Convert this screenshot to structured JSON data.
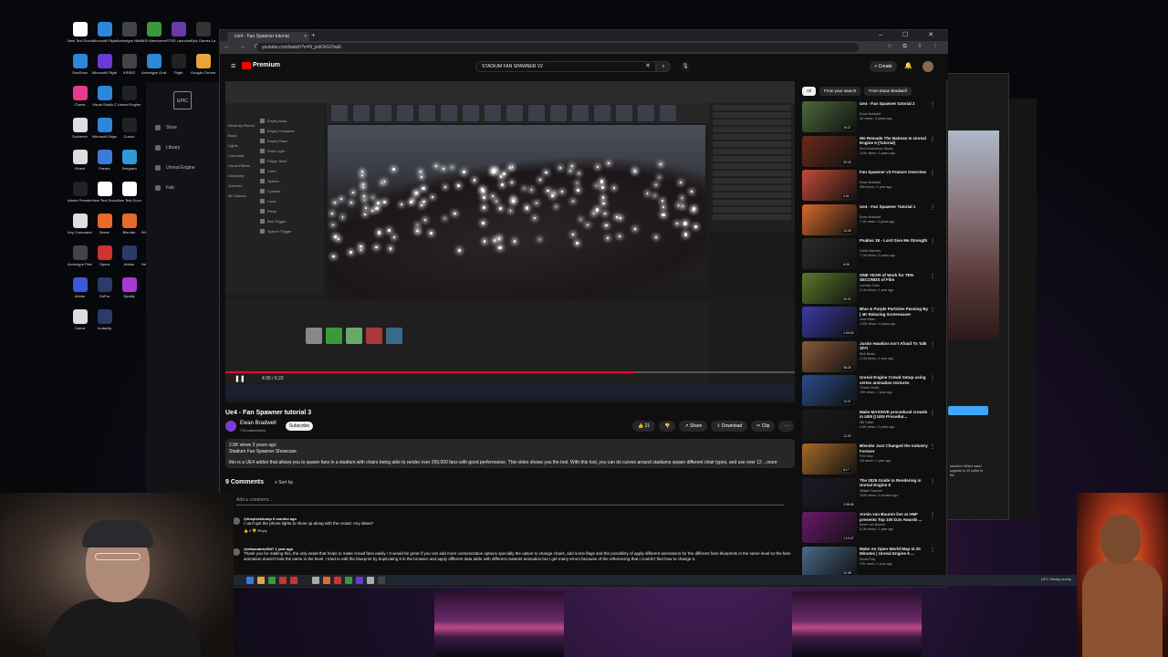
{
  "desktop": {
    "icons": [
      {
        "label": "New Text Document",
        "color": "#ffffff"
      },
      {
        "label": "Microsoft Flight Si...",
        "color": "#2e86d8"
      },
      {
        "label": "Archetype Nihilism",
        "color": "#444444"
      },
      {
        "label": "MSI Afterburner",
        "color": "#3a9a3a"
      },
      {
        "label": "RTSS Launcher",
        "color": "#6a3aa8"
      },
      {
        "label": "Epic Games Launcher",
        "color": "#333333"
      },
      {
        "label": "OneDrive",
        "color": "#2e86d8"
      },
      {
        "label": "Microsoft Flight Si...",
        "color": "#6a3ad8"
      },
      {
        "label": "KRISIS",
        "color": "#444444"
      },
      {
        "label": "Archetype Grabrush",
        "color": "#2e86d8"
      },
      {
        "label": "Flight",
        "color": "#222222"
      },
      {
        "label": "Google Chrome",
        "color": "#e8a33a"
      },
      {
        "label": "iTunes",
        "color": "#e83a8a"
      },
      {
        "label": "Visual Studio Code",
        "color": "#2e86d8"
      },
      {
        "label": "Unreal Engine",
        "color": "#222222"
      },
      {
        "label": "Fab",
        "color": "#cc3333"
      },
      {
        "label": "Archetype",
        "color": "#555555"
      },
      {
        "label": "SPOTIFY",
        "color": "#444444"
      },
      {
        "label": "Scrivener",
        "color": "#dddddd"
      },
      {
        "label": "Microsoft Edge",
        "color": "#2e86d8"
      },
      {
        "label": "Cursor",
        "color": "#222222"
      },
      {
        "label": "VRChat",
        "color": "#6a3ad8"
      },
      {
        "label": "Controller Pilot",
        "color": "#dddddd"
      },
      {
        "label": "Google Chrome",
        "color": "#3a9a3a"
      },
      {
        "label": "Kinect",
        "color": "#dddddd"
      },
      {
        "label": "Parsec",
        "color": "#3a7ad8"
      },
      {
        "label": "Telegram",
        "color": "#2e9ad8"
      },
      {
        "label": "Adobe",
        "color": "#3a5ad8"
      },
      {
        "label": "Skype",
        "color": "#2e9ad8"
      },
      {
        "label": "Recycle Bin",
        "color": "#dddddd"
      },
      {
        "label": "Adobe Premiere",
        "color": "#222222"
      },
      {
        "label": "New Text Document",
        "color": "#ffffff"
      },
      {
        "label": "New Text Document",
        "color": "#ffffff"
      },
      {
        "label": "Notion",
        "color": "#222222"
      },
      {
        "label": "New Text Document",
        "color": "#ffffff"
      },
      {
        "label": "Snipping Tool",
        "color": "#cc3333"
      },
      {
        "label": "Key Commands",
        "color": "#dddddd"
      },
      {
        "label": "Brave",
        "color": "#e86a2a"
      },
      {
        "label": "Blender",
        "color": "#e86a2a"
      },
      {
        "label": "World of Warcraft",
        "color": "#a87a2a"
      },
      {
        "label": "New Text Document",
        "color": "#ffffff"
      },
      {
        "label": "Brave",
        "color": "#a83a2a"
      },
      {
        "label": "Archetype Petrucci",
        "color": "#444444"
      },
      {
        "label": "Opera",
        "color": "#cc3333"
      },
      {
        "label": "Adobe",
        "color": "#2a3a6a"
      },
      {
        "label": "New Text Document",
        "color": "#ffffff"
      },
      {
        "label": "Archetype",
        "color": "#3a9a3a"
      },
      {
        "label": "Nvidia",
        "color": "#3a9a3a"
      },
      {
        "label": "Adobe",
        "color": "#3a5ad8"
      },
      {
        "label": "GoPro",
        "color": "#2a3a6a"
      },
      {
        "label": "Spotify",
        "color": "#a83ad8"
      },
      {
        "label": "Spotify",
        "color": "#dddddd"
      },
      {
        "label": "Adobe",
        "color": "#cc3333"
      },
      {
        "label": "Epic Games",
        "color": "#222222"
      },
      {
        "label": "Canva",
        "color": "#dddddd"
      },
      {
        "label": "Audacity",
        "color": "#2a3a6a"
      }
    ]
  },
  "epic_launcher": {
    "logo": "EPIC",
    "nav": [
      "Store",
      "Library",
      "Unreal Engine",
      "Fab"
    ]
  },
  "browser": {
    "tab_title": "Ue4 - Fan Spawner tutorial",
    "tab_close": "×",
    "new_tab": "+",
    "window_controls": "– ☐ ✕",
    "nav_buttons": "← → ⟳",
    "url": "youtube.com/watch?v=N_pxK3rGl7w&t",
    "extensions": "☆ ⧉ ⇩ ⋮"
  },
  "youtube": {
    "menu": "≡",
    "logo_text": "Premium",
    "search_value": "STADIUM FAN SPAWNER V2",
    "search_clear": "✕",
    "search_icon": "⌕",
    "mic_icon": "🎙",
    "create_label": "+ Create",
    "bell_icon": "🔔",
    "player": {
      "time": "4:35 / 6:23",
      "play_icon": "❚❚",
      "progress": 0.72,
      "progress_color": "#ff0033"
    },
    "video": {
      "title": "Ue4 - Fan Spawner tutorial 3",
      "channel": "Ewan Bradwell",
      "subscribers": "718 subscribers",
      "subscribe_label": "Subscribe",
      "like_count": "👍 21",
      "dislike": "👎",
      "share": "↗ Share",
      "download": "⇩ Download",
      "clip": "✂ Clip",
      "more": "⋯",
      "views": "2.5K views  3 years ago",
      "desc_title": "Stadium Fan Spawner Showcase",
      "desc_body": "this is a UE4 addon that allows you to spawn fans in a stadium with chairs being able to render over 250,000 fans with good performance. This video shows you the tool. With this tool, you can do curves around stadiums spawn different chair types, and use over 12 ...more"
    },
    "comments": {
      "count": "9 Comments",
      "sort_by": "≡ Sort by",
      "add_placeholder": "Add a comment...",
      "items": [
        {
          "author": "@thepixelslump  6 months ago",
          "text": "I can't get the phone lights to show up along with the crowd.  Any ideas?",
          "reply": "👍 0  👎  Reply"
        },
        {
          "author": "@ofmanatrix9647  1 year ago",
          "text": "Thank you for making this, the only asset that helps to make crowd fans easily ! It would be great if you can add more customization options specially the option to change chairs, add some flags and the possibility of apply different animations for the different fans blueprints in the same level so the fans animation doesn't look the same in the level. I tried to edit the blueprint by duplicating it in the browser and apply different data table with different materiel animation but I get many errors because of the referencing that I couldn't find how to change it.",
          "reply": ""
        }
      ]
    },
    "chips": [
      "All",
      "From your search",
      "From Ewan Bradwell"
    ],
    "recommendations": [
      {
        "title": "Ue4 - Fan Spawner tutorial 2",
        "channel": "Ewan Bradwell",
        "meta": "4K views • 3 years ago",
        "duration": "19:27",
        "color": "#4a6a3a"
      },
      {
        "title": "We Remade The Batman In Unreal Engine 5 (Tutorial)",
        "channel": "Red Dimensions Studio",
        "meta": "119K views • 3 years ago",
        "duration": "32:18",
        "color": "#6a2a1a"
      },
      {
        "title": "Fan Spawner v3 Feature Overview",
        "channel": "Ewan Bradwell",
        "meta": "888 views • 1 year ago",
        "duration": "4:41",
        "color": "#c84a3a"
      },
      {
        "title": "Ue4 - Fan Spawner Tutorial 1",
        "channel": "Ewan Bradwell",
        "meta": "7.4K views • 3 years ago",
        "duration": "19:26",
        "color": "#d86a2a"
      },
      {
        "title": "Psalms 18 - Lord Give Me Strength",
        "channel": "Christ Warriors",
        "meta": "7.1M views • 3 years ago",
        "duration": "6:39",
        "color": "#2a2a2a"
      },
      {
        "title": "ONE YEAR of Work for TEN SECONDS of Film",
        "channel": "Corridor Crew",
        "meta": "2.1M views • 1 year ago",
        "duration": "30:23",
        "color": "#5a7a2a"
      },
      {
        "title": "Blue & Purple Particles Passing By | 4K Relaxing Screensaver",
        "channel": "Jess Relax",
        "meta": "120K views • 3 years ago",
        "duration": "1:00:00",
        "color": "#3a3aa8"
      },
      {
        "title": "Justin Hawkins Isn't Afraid To Talk Sh*t",
        "channel": "Rick Beato",
        "meta": "2.1M views • 1 year ago",
        "duration": "38:26",
        "color": "#8a5a3a"
      },
      {
        "title": "Unreal Engine Crowd Setup using vertex animation textures",
        "channel": "Tharlis Studio",
        "meta": "19K views • 1 year ago",
        "duration": "12:37",
        "color": "#2a4a8a"
      },
      {
        "title": "Make MASSIVE procedural crowds in UE5 || UE5 Procedur...",
        "channel": "Nik Gallet",
        "meta": "6.6K views • 2 years ago",
        "duration": "12:20",
        "color": "#1a1a1a"
      },
      {
        "title": "Blender Just Changed the Industry Forever",
        "channel": "Film Stop",
        "meta": "1M views • 1 year ago",
        "duration": "8:17",
        "color": "#a86a2a"
      },
      {
        "title": "The 2025 Guide to Rendering in Unreal Engine 5",
        "channel": "William Faucher",
        "meta": "114K views • 4 months ago",
        "duration": "2:08:55",
        "color": "#1a1a2a"
      },
      {
        "title": "Armin van Buuren live at AMF presents Top 100 DJs Awards ...",
        "channel": "Armin van Buuren",
        "meta": "5.1M views • 1 year ago",
        "duration": "1:14:47",
        "color": "#6a1a6a"
      },
      {
        "title": "Make An Open World Map In 20 Minutes | Unreal Engine 5 ...",
        "channel": "Smart Poly",
        "meta": "97K views • 1 year ago",
        "duration": "22:38",
        "color": "#4a6a8a"
      }
    ]
  },
  "taskbar": {
    "icons": [
      "#3a7ad8",
      "#e8a33a",
      "#3a9a3a",
      "#cc3333",
      "#cc3333",
      "#222222",
      "#aaaaaa",
      "#e86a2a",
      "#cc3333",
      "#3a9a3a",
      "#6a3ad8",
      "#aaaaaa",
      "#444444"
    ],
    "tray": "18°C  Mostly sunny"
  },
  "ue": {
    "place_actors": [
      "Empty Actor",
      "Empty Character",
      "Empty Pawn",
      "Point Light",
      "Player Start",
      "Cube",
      "Sphere",
      "Cylinder",
      "Cone",
      "Plane",
      "Box Trigger",
      "Sphere Trigger"
    ],
    "categories": [
      "Recently Placed",
      "Basic",
      "Lights",
      "Cinematic",
      "Visual Effects",
      "Geometry",
      "Volumes",
      "All Classes"
    ]
  }
}
